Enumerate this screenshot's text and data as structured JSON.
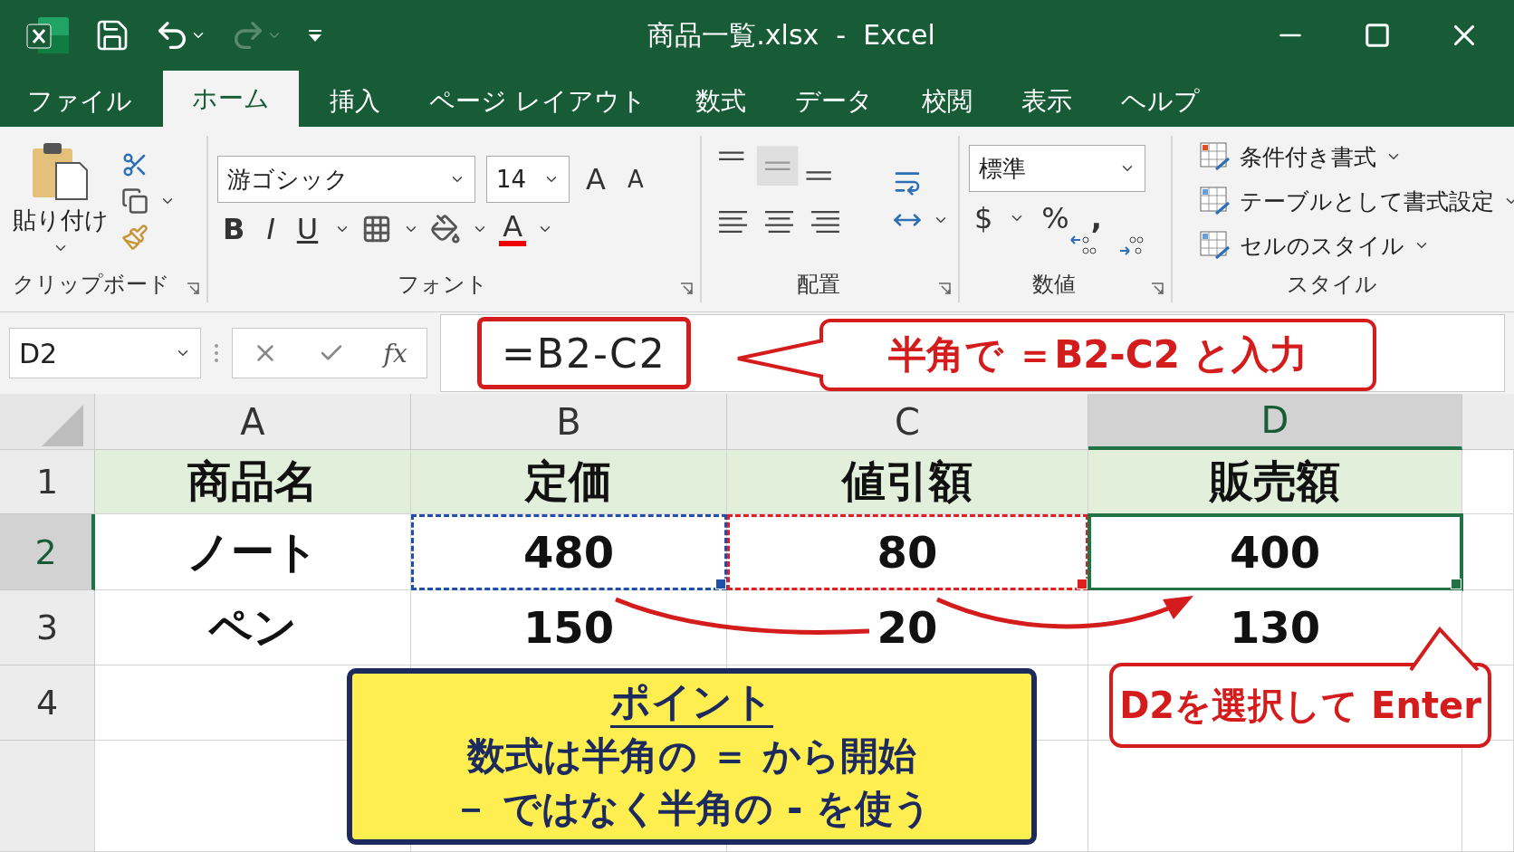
{
  "window": {
    "title": "商品一覧.xlsx  -  Excel"
  },
  "tabs": [
    {
      "label": "ファイル",
      "selected": false
    },
    {
      "label": "ホーム",
      "selected": true
    },
    {
      "label": "挿入",
      "selected": false
    },
    {
      "label": "ページ レイアウト",
      "selected": false
    },
    {
      "label": "数式",
      "selected": false
    },
    {
      "label": "データ",
      "selected": false
    },
    {
      "label": "校閲",
      "selected": false
    },
    {
      "label": "表示",
      "selected": false
    },
    {
      "label": "ヘルプ",
      "selected": false
    }
  ],
  "ribbon": {
    "clipboard": {
      "paste": "貼り付け",
      "label": "クリップボード"
    },
    "font": {
      "name": "游ゴシック",
      "size": "14",
      "grow": "A",
      "shrink": "A",
      "styles": [
        {
          "label": "B",
          "kind": "bold"
        },
        {
          "label": "I",
          "kind": "italic"
        },
        {
          "label": "U",
          "kind": "underline"
        }
      ],
      "color_label": "A",
      "label": "フォント"
    },
    "alignment": {
      "label": "配置"
    },
    "number": {
      "format": "標準",
      "currency": "$",
      "percent": "%",
      "comma": ",",
      "label": "数値"
    },
    "styles": {
      "items": [
        "条件付き書式",
        "テーブルとして書式設定",
        "セルのスタイル"
      ],
      "label": "スタイル"
    }
  },
  "formula_bar": {
    "name_box": "D2",
    "fx": "fx",
    "formula": "=B2-C2"
  },
  "sheet": {
    "columns": [
      {
        "label": "A",
        "selected": false
      },
      {
        "label": "B",
        "selected": false
      },
      {
        "label": "C",
        "selected": false
      },
      {
        "label": "D",
        "selected": true
      }
    ],
    "rows": [
      {
        "number": "1",
        "selected": false,
        "kind": "header",
        "cells": [
          {
            "text": "商品名",
            "selected": false
          },
          {
            "text": "定価",
            "selected": false
          },
          {
            "text": "値引額",
            "selected": false
          },
          {
            "text": "販売額",
            "selected": false
          }
        ]
      },
      {
        "number": "2",
        "selected": true,
        "kind": "data",
        "cells": [
          {
            "text": "ノート",
            "selected": false
          },
          {
            "text": "480",
            "selected": false,
            "color": "#1f4fa8"
          },
          {
            "text": "80",
            "selected": false,
            "color": "#e02020"
          },
          {
            "text": "400",
            "selected": true
          }
        ]
      },
      {
        "number": "3",
        "selected": false,
        "kind": "data",
        "cells": [
          {
            "text": "ペン",
            "selected": false
          },
          {
            "text": "150",
            "selected": false
          },
          {
            "text": "20",
            "selected": false
          },
          {
            "text": "130",
            "selected": false
          }
        ]
      },
      {
        "number": "4",
        "selected": false,
        "kind": "data",
        "cells": []
      }
    ]
  },
  "annotations": {
    "formula_callout": "半角で ＝B2-C2 と入力",
    "point": {
      "title": "ポイント",
      "lines": [
        "数式は半角の ＝ から開始",
        "－ ではなく半角の - を使う"
      ]
    },
    "enter_callout": "D2を選択して Enter"
  }
}
